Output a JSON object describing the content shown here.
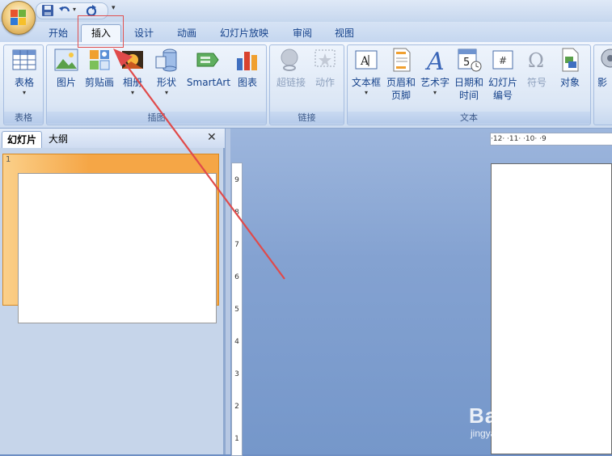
{
  "quick_access": {
    "icons": [
      "save-icon",
      "undo-icon",
      "redo-icon"
    ],
    "more_label": "▾"
  },
  "tabs": [
    {
      "label": "开始",
      "active": false
    },
    {
      "label": "插入",
      "active": true
    },
    {
      "label": "设计",
      "active": false
    },
    {
      "label": "动画",
      "active": false
    },
    {
      "label": "幻灯片放映",
      "active": false
    },
    {
      "label": "审阅",
      "active": false
    },
    {
      "label": "视图",
      "active": false
    }
  ],
  "ribbon": {
    "groups": [
      {
        "label": "表格",
        "buttons": [
          {
            "label": "表格",
            "icon": "table-icon",
            "caret": "▾"
          }
        ]
      },
      {
        "label": "插图",
        "buttons": [
          {
            "label": "图片",
            "icon": "picture-icon"
          },
          {
            "label": "剪贴画",
            "icon": "clipart-icon"
          },
          {
            "label": "相册",
            "icon": "photo-album-icon",
            "caret": "▾"
          },
          {
            "label": "形状",
            "icon": "shapes-icon",
            "caret": "▾"
          },
          {
            "label": "SmartArt",
            "icon": "smartart-icon"
          },
          {
            "label": "图表",
            "icon": "chart-icon"
          }
        ]
      },
      {
        "label": "链接",
        "buttons": [
          {
            "label": "超链接",
            "icon": "hyperlink-icon",
            "disabled": true
          },
          {
            "label": "动作",
            "icon": "action-icon",
            "disabled": true
          }
        ]
      },
      {
        "label": "文本",
        "buttons": [
          {
            "label": "文本框",
            "icon": "textbox-icon",
            "caret": "▾"
          },
          {
            "label": "页眉和\n页脚",
            "label1": "页眉和",
            "label2": "页脚",
            "icon": "header-footer-icon"
          },
          {
            "label": "艺术字",
            "icon": "wordart-icon",
            "caret": "▾"
          },
          {
            "label": "日期和时间",
            "label1": "日期和",
            "label2": "时间",
            "icon": "date-time-icon"
          },
          {
            "label": "幻灯片编号",
            "label1": "幻灯片",
            "label2": "编号",
            "icon": "slide-number-icon"
          },
          {
            "label": "符号",
            "icon": "symbol-icon",
            "disabled": true
          },
          {
            "label": "对象",
            "icon": "object-icon"
          }
        ]
      },
      {
        "label": "",
        "buttons": [
          {
            "label": "影",
            "icon": "movie-icon"
          }
        ]
      }
    ]
  },
  "left_panel": {
    "tabs": [
      {
        "label": "幻灯片",
        "active": true
      },
      {
        "label": "大纲",
        "active": false
      }
    ],
    "close_label": "✕",
    "slide_number": "1"
  },
  "horizontal_ruler": "·12·  ·11·  ·10·  ·9",
  "vertical_ruler": [
    "9",
    "8",
    "7",
    "6",
    "5",
    "4",
    "3",
    "2",
    "1"
  ],
  "watermark": {
    "main": "Bai du 经验",
    "sub": "jingyan.baidu.com"
  },
  "colors": {
    "accent_orange": "#f5a646",
    "annotation_red": "#e04a4a"
  }
}
